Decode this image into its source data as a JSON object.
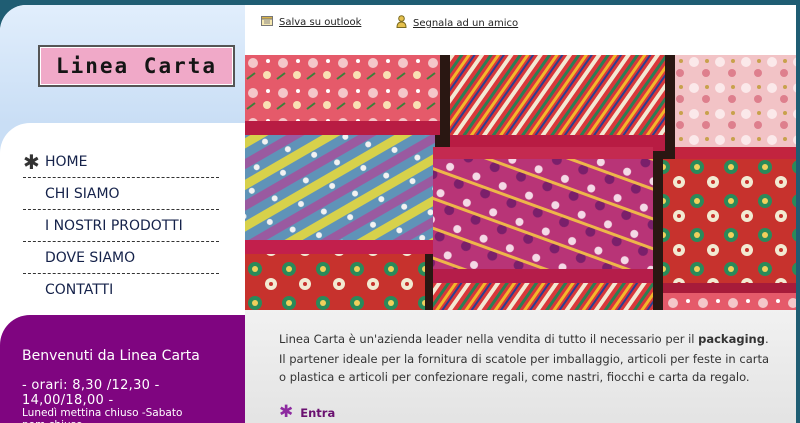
{
  "logo": {
    "text": "Linea Carta"
  },
  "topbar": {
    "save_outlook": "Salva su outlook",
    "tell_friend": "Segnala ad un amico"
  },
  "nav": {
    "items": [
      {
        "label": "HOME",
        "active": true
      },
      {
        "label": "CHI SIAMO",
        "active": false
      },
      {
        "label": "I NOSTRI PRODOTTI",
        "active": false
      },
      {
        "label": "DOVE SIAMO",
        "active": false
      },
      {
        "label": "CONTATTI",
        "active": false
      }
    ]
  },
  "welcome": {
    "title": "Benvenuti da Linea Carta",
    "hours": "- orari: 8,30 /12,30 - 14,00/18,00 -",
    "closed": "Lunedì mettina chiuso -Sabato pom.chiuso"
  },
  "content": {
    "intro_prefix": "Linea Carta è un'azienda leader nella vendita di tutto il necessario per il ",
    "intro_bold": "packaging",
    "intro_suffix": ".",
    "intro2": "Il partener ideale per la fornitura di scatole per imballaggio, articoli per feste in carta o plastica e articoli per confezionare regali, come nastri, fiocchi e carta da regalo.",
    "enter": "Entra"
  },
  "colors": {
    "frame": "#1f5d73",
    "welcome_bg": "#7f0580",
    "logo_bg": "#f0a9c8",
    "nav_text": "#15224a",
    "accent": "#6a1070"
  },
  "icons": {
    "nav_active": "asterisk-icon",
    "save": "calendar-icon",
    "share": "person-icon",
    "enter": "asterisk-icon"
  }
}
